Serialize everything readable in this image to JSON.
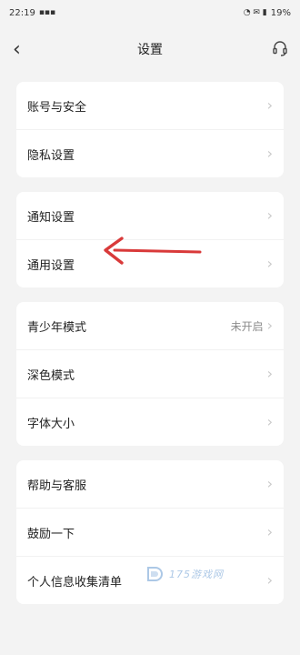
{
  "status": {
    "time": "22:19",
    "battery": "19%"
  },
  "header": {
    "title": "设置"
  },
  "groups": [
    [
      {
        "label": "账号与安全"
      },
      {
        "label": "隐私设置"
      }
    ],
    [
      {
        "label": "通知设置"
      },
      {
        "label": "通用设置"
      }
    ],
    [
      {
        "label": "青少年模式",
        "value": "未开启"
      },
      {
        "label": "深色模式"
      },
      {
        "label": "字体大小"
      }
    ],
    [
      {
        "label": "帮助与客服"
      },
      {
        "label": "鼓励一下"
      },
      {
        "label": "个人信息收集清单"
      }
    ]
  ],
  "watermark": {
    "text": "175游戏网"
  },
  "colors": {
    "background": "#f3f3f3",
    "card": "#ffffff",
    "arrow": "#d93a3a"
  },
  "icons": {
    "back": "back-chevron-icon",
    "headset": "headset-icon",
    "row_chevron": "chevron-right-icon"
  }
}
